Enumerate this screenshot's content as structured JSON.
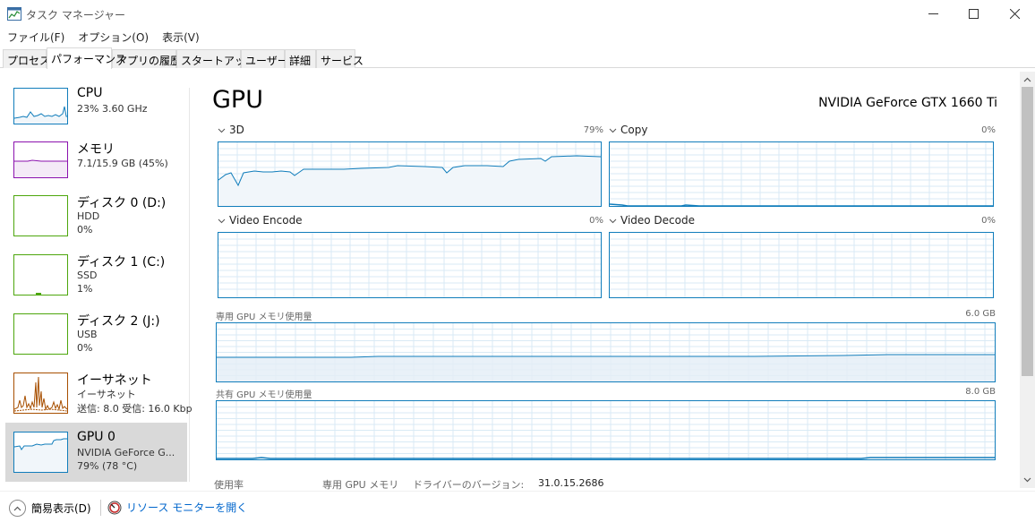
{
  "window": {
    "title": "タスク マネージャー"
  },
  "menu": [
    "ファイル(F)",
    "オプション(O)",
    "表示(V)"
  ],
  "tabs": [
    "プロセス",
    "パフォーマンス",
    "アプリの履歴",
    "スタートアップ",
    "ユーザー",
    "詳細",
    "サービス"
  ],
  "sidebar": {
    "items": [
      {
        "name": "CPU",
        "sub1": "23%  3.60 GHz",
        "sub2": "",
        "sub3": ""
      },
      {
        "name": "メモリ",
        "sub1": "7.1/15.9 GB (45%)",
        "sub2": "",
        "sub3": ""
      },
      {
        "name": "ディスク 0 (D:)",
        "sub1": "HDD",
        "sub2": "0%",
        "sub3": ""
      },
      {
        "name": "ディスク 1 (C:)",
        "sub1": "SSD",
        "sub2": "1%",
        "sub3": ""
      },
      {
        "name": "ディスク 2 (J:)",
        "sub1": "USB",
        "sub2": "0%",
        "sub3": ""
      },
      {
        "name": "イーサネット",
        "sub1": "イーサネット",
        "sub2": "送信: 8.0  受信: 16.0 Kbp",
        "sub3": ""
      },
      {
        "name": "GPU 0",
        "sub1": "NVIDIA GeForce G...",
        "sub2": "79% (78 °C)",
        "sub3": ""
      }
    ],
    "colors": {
      "cpu": "#117dbb",
      "memory": "#8b12ae",
      "disk": "#4da60c",
      "ethernet": "#a74f01",
      "gpu": "#117dbb"
    }
  },
  "main": {
    "title": "GPU",
    "model": "NVIDIA GeForce GTX 1660 Ti",
    "graphs": [
      {
        "label": "3D",
        "pct": "79%"
      },
      {
        "label": "Copy",
        "pct": "0%"
      },
      {
        "label": "Video Encode",
        "pct": "0%"
      },
      {
        "label": "Video Decode",
        "pct": "0%"
      }
    ],
    "dedicated_mem": {
      "label": "専用 GPU メモリ使用量",
      "max": "6.0 GB"
    },
    "shared_mem": {
      "label": "共有 GPU メモリ使用量",
      "max": "8.0 GB"
    },
    "stats": {
      "usage_label": "使用率",
      "dedicated_label": "専用 GPU メモリ",
      "driver_label": "ドライバーのバージョン:",
      "driver_value": "31.0.15.2686"
    }
  },
  "footer": {
    "fewer_details": "簡易表示(D)",
    "resource_monitor": "リソース モニターを開く"
  }
}
